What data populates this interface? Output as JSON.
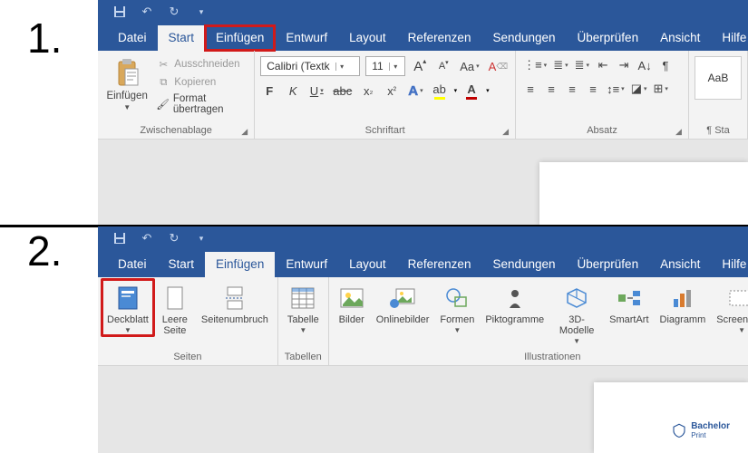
{
  "qat": {
    "save": "💾",
    "undo": "↶",
    "redo": "↻",
    "custom": "▾"
  },
  "tabs": {
    "items": [
      "Datei",
      "Start",
      "Einfügen",
      "Entwurf",
      "Layout",
      "Referenzen",
      "Sendungen",
      "Überprüfen",
      "Ansicht",
      "Hilfe"
    ]
  },
  "step1": {
    "number": "1.",
    "active_tab": "Start",
    "highlight_tab": "Einfügen",
    "groups": {
      "clipboard": {
        "label": "Zwischenablage",
        "paste": "Einfügen",
        "cut": "Ausschneiden",
        "copy": "Kopieren",
        "formatpainter": "Format übertragen"
      },
      "font": {
        "label": "Schriftart",
        "name": "Calibri (Textk",
        "size": "11",
        "grow": "A",
        "shrink": "A",
        "case": "Aa",
        "clear": "✐"
      },
      "paragraph": {
        "label": "Absatz"
      },
      "styles": {
        "box1": "AaB"
      }
    }
  },
  "step2": {
    "number": "2.",
    "active_tab": "Einfügen",
    "highlight_btn": "Deckblatt",
    "groups": {
      "pages": {
        "label": "Seiten",
        "cover": "Deckblatt",
        "blank": "Leere Seite",
        "break": "Seitenumbruch"
      },
      "tables": {
        "label": "Tabellen",
        "table": "Tabelle"
      },
      "illus": {
        "label": "Illustrationen",
        "pic": "Bilder",
        "online": "Onlinebilder",
        "shapes": "Formen",
        "icons": "Piktogramme",
        "models": "3D-Modelle",
        "smartart": "SmartArt",
        "chart": "Diagramm",
        "screenshot": "Screenshot"
      }
    }
  },
  "watermark": {
    "name": "Bachelor",
    "sub": "Print"
  }
}
